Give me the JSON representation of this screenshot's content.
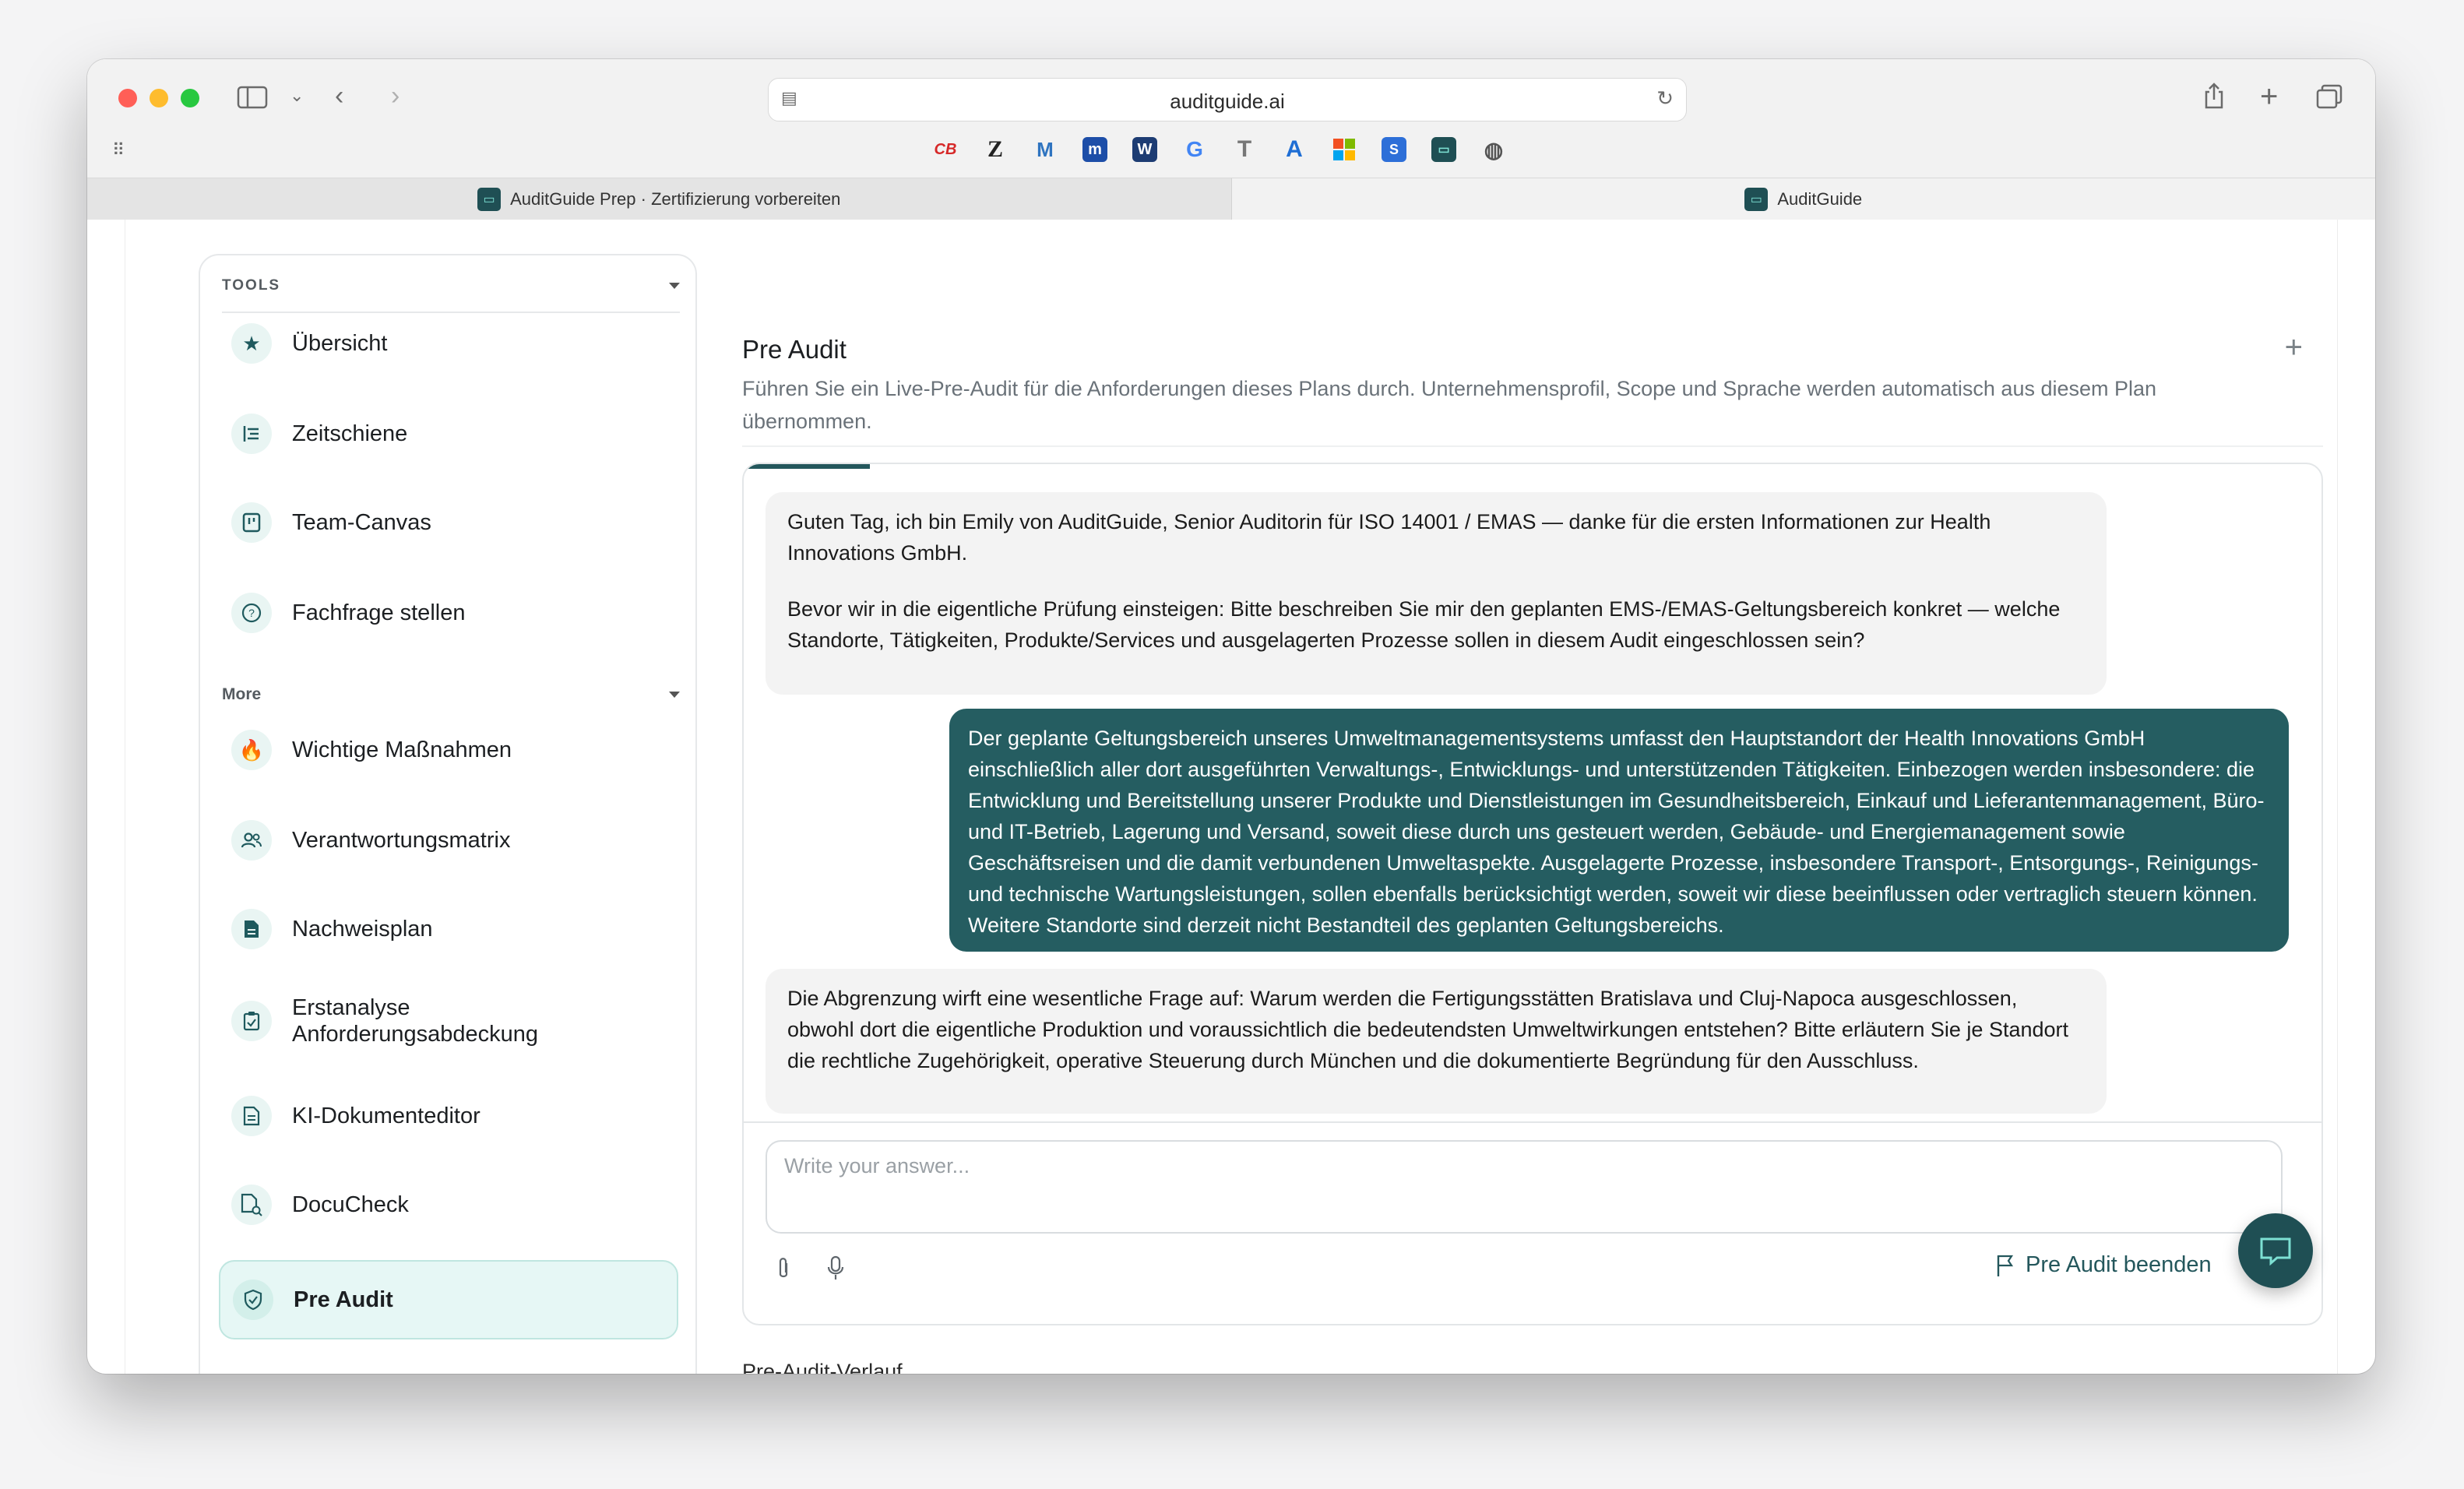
{
  "browser": {
    "url": "auditguide.ai",
    "tabs": [
      {
        "label": "AuditGuide Prep · Zertifizierung vorbereiten",
        "active": false
      },
      {
        "label": "AuditGuide",
        "active": true
      }
    ],
    "favorites": [
      "cb",
      "z",
      "m",
      "m",
      "w",
      "g",
      "t",
      "a",
      "ms",
      "s",
      "ag",
      "globe"
    ]
  },
  "sidebar": {
    "tools_heading": "TOOLS",
    "more_heading": "More",
    "tools": [
      {
        "label": "Übersicht",
        "icon": "star-icon"
      },
      {
        "label": "Zeitschiene",
        "icon": "timeline-icon"
      },
      {
        "label": "Team-Canvas",
        "icon": "canvas-icon"
      },
      {
        "label": "Fachfrage stellen",
        "icon": "question-icon"
      }
    ],
    "more": [
      {
        "label": "Wichtige Maßnahmen",
        "icon": "fire-icon"
      },
      {
        "label": "Verantwortungsmatrix",
        "icon": "users-icon"
      },
      {
        "label": "Nachweisplan",
        "icon": "document-icon"
      },
      {
        "label": "Erstanalyse Anforderungsabdeckung",
        "icon": "clipboard-check-icon"
      },
      {
        "label": "KI-Dokumenteditor",
        "icon": "edit-document-icon"
      },
      {
        "label": "DocuCheck",
        "icon": "document-search-icon"
      },
      {
        "label": "Pre Audit",
        "icon": "shield-check-icon",
        "active": true
      }
    ]
  },
  "main": {
    "title": "Pre Audit",
    "subtitle": "Führen Sie ein Live-Pre-Audit für die Anforderungen dieses Plans durch. Unternehmensprofil, Scope und Sprache werden automatisch aus diesem Plan übernommen.",
    "messages": [
      {
        "role": "bot",
        "paragraphs": [
          "Guten Tag, ich bin Emily von AuditGuide, Senior Auditorin für ISO 14001 / EMAS — danke für die ersten Informationen zur Health Innovations GmbH.",
          "Bevor wir in die eigentliche Prüfung einsteigen: Bitte beschreiben Sie mir den geplanten EMS-/EMAS-Geltungsbereich konkret — welche Standorte, Tätigkeiten, Produkte/Services und ausgelagerten Prozesse sollen in diesem Audit eingeschlossen sein?"
        ]
      },
      {
        "role": "user",
        "paragraphs": [
          "Der geplante Geltungsbereich unseres Umweltmanagementsystems umfasst den Hauptstandort der Health Innovations GmbH einschließlich aller dort ausgeführten Verwaltungs-, Entwicklungs- und unterstützenden Tätigkeiten. Einbezogen werden insbesondere: die Entwicklung und Bereitstellung unserer Produkte und Dienstleistungen im Gesundheitsbereich, Einkauf und Lieferantenmanagement, Büro- und IT-Betrieb, Lagerung und Versand, soweit diese durch uns gesteuert werden, Gebäude- und Energiemanagement sowie Geschäftsreisen und die damit verbundenen Umweltaspekte. Ausgelagerte Prozesse, insbesondere Transport-, Entsorgungs-, Reinigungs- und technische Wartungsleistungen, sollen ebenfalls berücksichtigt werden, soweit wir diese beeinflussen oder vertraglich steuern können. Weitere Standorte sind derzeit nicht Bestandteil des geplanten Geltungsbereichs."
        ]
      },
      {
        "role": "bot",
        "paragraphs": [
          "Die Abgrenzung wirft eine wesentliche Frage auf: Warum werden die Fertigungsstätten Bratislava und Cluj-Napoca ausgeschlossen, obwohl dort die eigentliche Produktion und voraussichtlich die bedeutendsten Umweltwirkungen entstehen? Bitte erläutern Sie je Standort die rechtliche Zugehörigkeit, operative Steuerung durch München und die dokumentierte Begründung für den Ausschluss."
        ]
      }
    ],
    "input": {
      "placeholder": "Write your answer...",
      "value": ""
    },
    "end_button": "Pre Audit beenden",
    "below_heading": "Pre-Audit-Verlauf"
  },
  "colors": {
    "accent": "#255d61",
    "accent_light": "#e6f7f5",
    "bot_bubble": "#f3f3f3"
  }
}
